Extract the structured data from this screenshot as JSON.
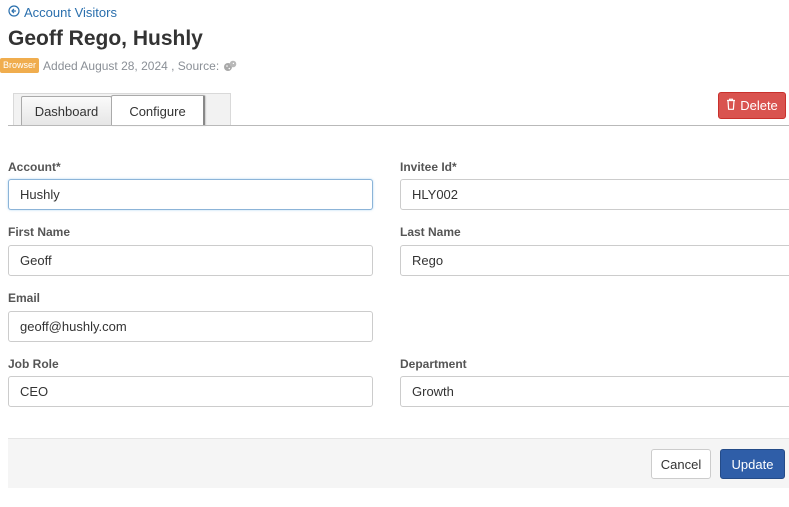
{
  "nav": {
    "back_label": "Account Visitors"
  },
  "header": {
    "title": "Geoff Rego, Hushly",
    "badge": "Browser",
    "added_text": "Added August 28, 2024 , Source:",
    "source_icon": "cookie-icon"
  },
  "tabs": [
    {
      "label": "Dashboard",
      "active": false
    },
    {
      "label": "Configure",
      "active": true
    }
  ],
  "actions": {
    "delete_label": "Delete"
  },
  "form": {
    "account": {
      "label": "Account*",
      "value": "Hushly"
    },
    "invitee_id": {
      "label": "Invitee Id*",
      "value": "HLY002"
    },
    "first_name": {
      "label": "First Name",
      "value": "Geoff"
    },
    "last_name": {
      "label": "Last Name",
      "value": "Rego"
    },
    "email": {
      "label": "Email",
      "value": "geoff@hushly.com"
    },
    "job_role": {
      "label": "Job Role",
      "value": "CEO"
    },
    "department": {
      "label": "Department",
      "value": "Growth"
    }
  },
  "footer": {
    "cancel_label": "Cancel",
    "update_label": "Update"
  },
  "colors": {
    "link": "#2a6fad",
    "badge": "#f0ad4e",
    "danger": "#d9534f",
    "primary": "#2f5ea8"
  }
}
